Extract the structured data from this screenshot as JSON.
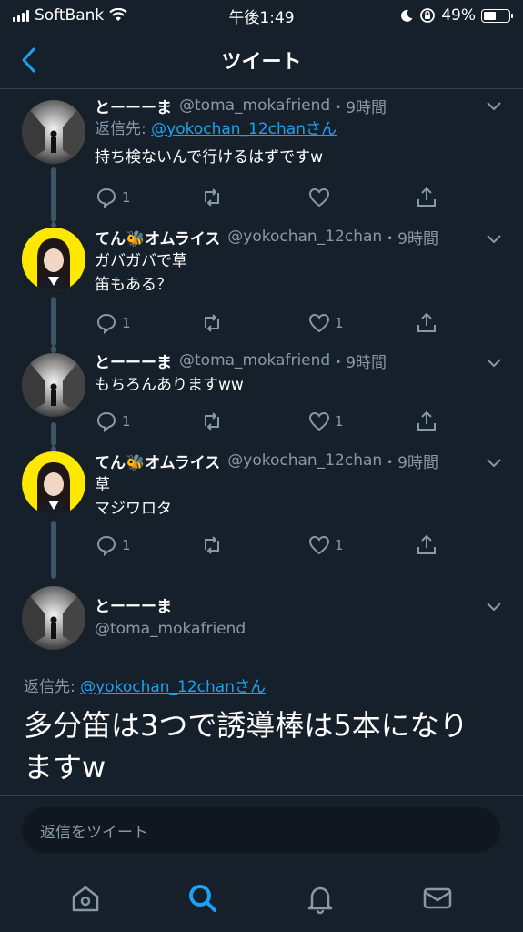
{
  "status_bar": {
    "carrier": "SoftBank",
    "time": "午後1:49",
    "battery_percent_text": "49%",
    "battery_level": 0.49
  },
  "nav": {
    "title": "ツイート"
  },
  "tweets": [
    {
      "name": "とーーーま",
      "handle": "@toma_mokafriend",
      "dot": "・",
      "time": "9時間",
      "reply_label": "返信先: ",
      "reply_user": "@yokochan_12chanさん",
      "text_lines": [
        "持ち検ないんで行けるはずですw"
      ],
      "reply_count": "1",
      "like_count": ""
    },
    {
      "name": "てん🐝オムライス",
      "handle": "@yokochan_12chan",
      "dot": "・",
      "time": "9時間",
      "text_lines": [
        "ガバガバで草",
        "笛もある？"
      ],
      "reply_count": "1",
      "like_count": "1"
    },
    {
      "name": "とーーーま",
      "handle": "@toma_mokafriend",
      "dot": "・",
      "time": "9時間",
      "text_lines": [
        "もちろんありますww"
      ],
      "reply_count": "1",
      "like_count": "1"
    },
    {
      "name": "てん🐝オムライス",
      "handle": "@yokochan_12chan",
      "dot": "・",
      "time": "9時間",
      "text_lines": [
        "草",
        "マジワロタ"
      ],
      "reply_count": "1",
      "like_count": "1"
    }
  ],
  "main_tweet": {
    "name": "とーーーま",
    "handle": "@toma_mokafriend",
    "reply_label": "返信先: ",
    "reply_user": "@yokochan_12chanさん",
    "text": "多分笛は3つで誘導棒は5本になりますw"
  },
  "compose": {
    "placeholder": "返信をツイート"
  },
  "tabs": [
    "home-icon",
    "search-icon",
    "notifications-icon",
    "messages-icon"
  ],
  "colors": {
    "background": "#15202b",
    "accent": "#1da1f2",
    "secondary_text": "#8899a6"
  }
}
